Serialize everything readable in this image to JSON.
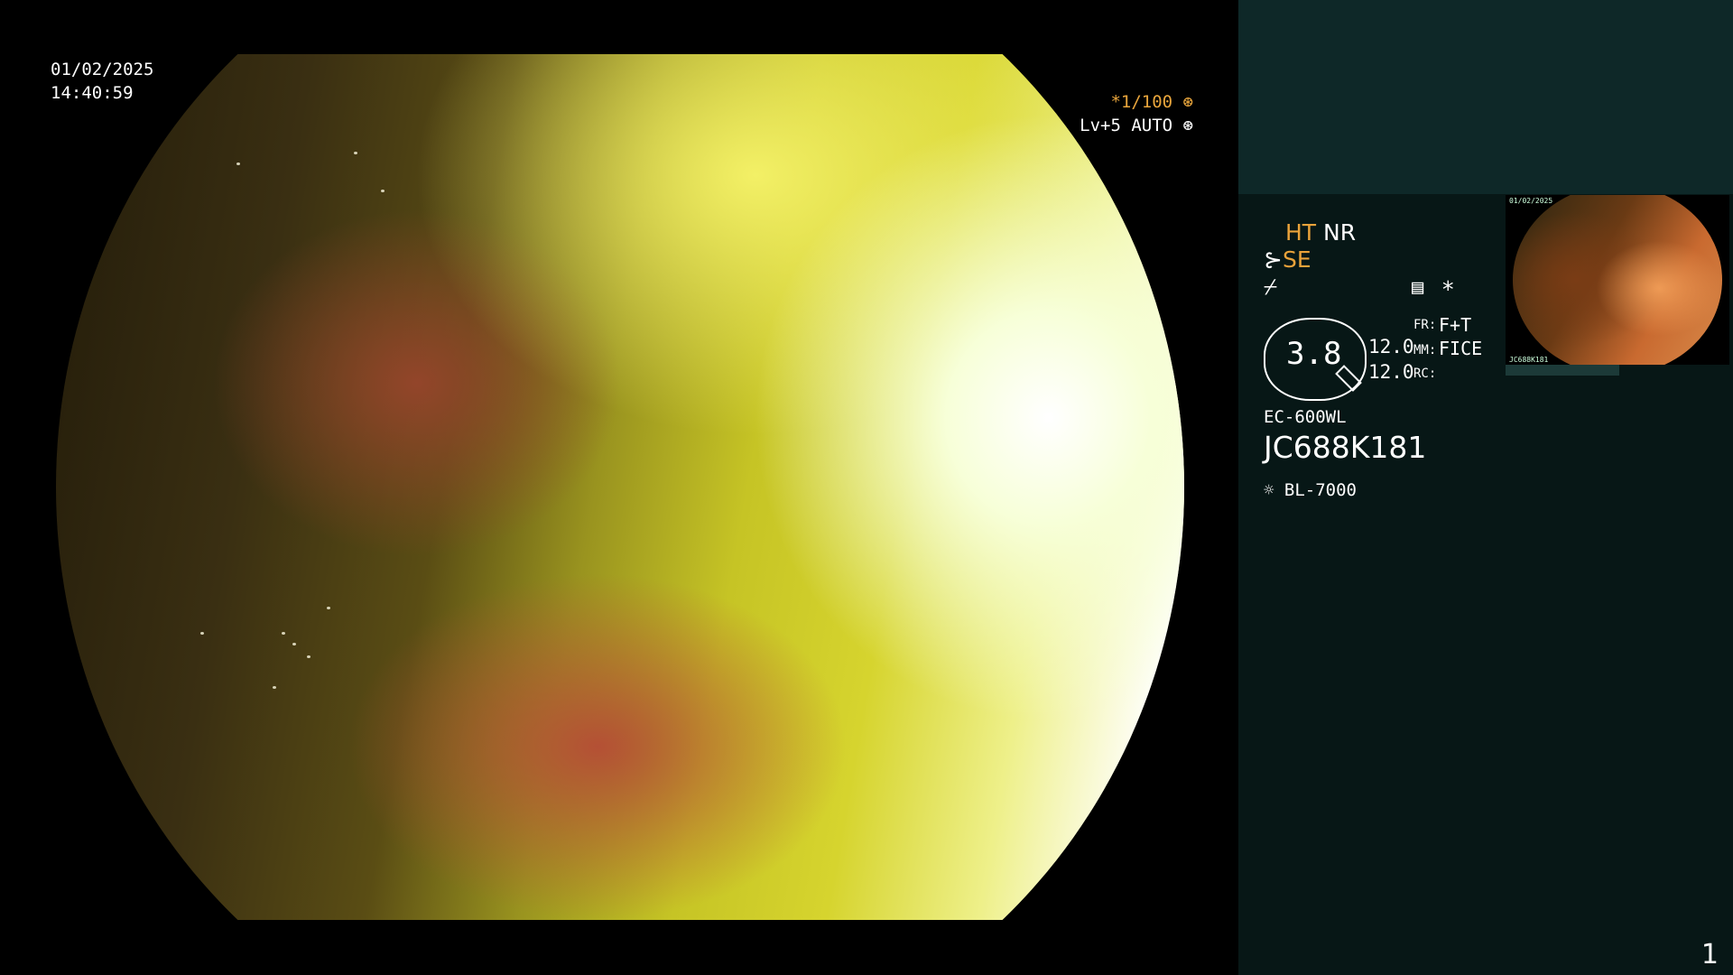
{
  "overlay": {
    "date": "01/02/2025",
    "time": "14:40:59",
    "shutter": "*1/100",
    "shutter_icon": "aperture-icon",
    "level": "Lv+5 AUTO",
    "level_icon": "aperture-icon"
  },
  "panel": {
    "ht": "HT",
    "nr": "NR",
    "se": "SE",
    "se_icon": "scope-icon",
    "fn_icon": "lightning-icon",
    "menu_icon": "settings-icon",
    "asterisk": "*",
    "zoom": "3.8",
    "val1": "12.0",
    "val2": "12.0",
    "fr_label": "FR:",
    "fr_value": "F+T",
    "mm_label": "MM:",
    "mm_value": "FICE",
    "rc_label": "RC:",
    "model": "EC-600WL",
    "serial": "JC688K181",
    "light_source": "BL-7000",
    "light_icon": "sun-icon",
    "page_number": "1"
  },
  "thumbnail": {
    "label_top": "01/02/2025",
    "label_bottom": "JC688K181"
  },
  "colors": {
    "accent": "#e9a23a",
    "panel_bg": "#071716",
    "panel_top_bg": "#0e2828"
  }
}
